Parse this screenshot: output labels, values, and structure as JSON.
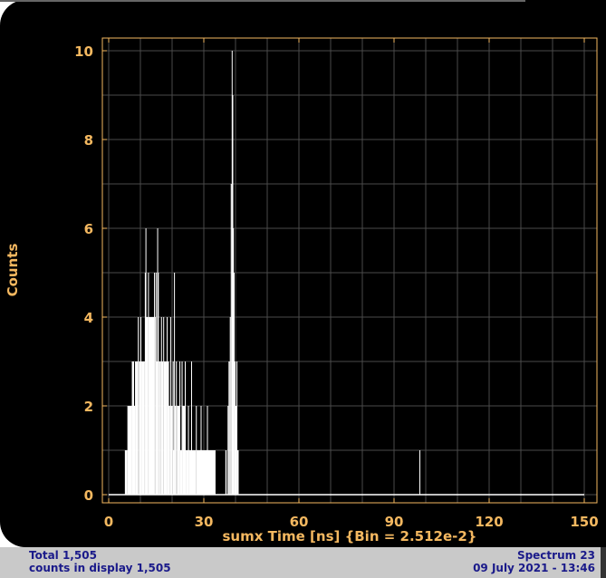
{
  "chart_data": {
    "type": "bar",
    "title": "",
    "xlabel": "sumx Time [ns] {Bin = 2.512e-2}",
    "ylabel": "Counts",
    "xlim": [
      -2,
      152
    ],
    "ylim": [
      -0.2,
      10.3
    ],
    "xticks": [
      "0",
      "30",
      "60",
      "90",
      "120",
      "150"
    ],
    "xtick_values": [
      0,
      30,
      60,
      90,
      120,
      150
    ],
    "yticks": [
      "0",
      "2",
      "4",
      "6",
      "8",
      "10"
    ],
    "ytick_values": [
      0,
      2,
      4,
      6,
      8,
      10
    ],
    "grid": true,
    "segments": [
      [
        5.1,
        5.9,
        1
      ],
      [
        5.9,
        7.3,
        2
      ],
      [
        7.3,
        8.0,
        3
      ],
      [
        8.0,
        8.3,
        2
      ],
      [
        8.3,
        9.2,
        3
      ],
      [
        9.2,
        9.5,
        4
      ],
      [
        9.5,
        10.0,
        3
      ],
      [
        10.0,
        10.3,
        4
      ],
      [
        10.3,
        11.4,
        3
      ],
      [
        11.4,
        11.6,
        5
      ],
      [
        11.6,
        11.8,
        6
      ],
      [
        11.8,
        12.4,
        4
      ],
      [
        12.4,
        12.6,
        5
      ],
      [
        12.6,
        14.3,
        4
      ],
      [
        14.3,
        14.5,
        5
      ],
      [
        14.5,
        14.8,
        4
      ],
      [
        14.8,
        15.0,
        5
      ],
      [
        15.0,
        15.3,
        3
      ],
      [
        15.3,
        15.4,
        6
      ],
      [
        15.4,
        15.8,
        5
      ],
      [
        15.8,
        16.5,
        3
      ],
      [
        16.5,
        16.7,
        4
      ],
      [
        16.7,
        17.2,
        3
      ],
      [
        17.2,
        17.4,
        4
      ],
      [
        17.4,
        18.3,
        3
      ],
      [
        18.3,
        18.5,
        4
      ],
      [
        18.5,
        19.0,
        3
      ],
      [
        19.0,
        19.4,
        2
      ],
      [
        19.4,
        19.6,
        4
      ],
      [
        19.6,
        20.2,
        2
      ],
      [
        20.2,
        20.4,
        3
      ],
      [
        20.4,
        20.6,
        1
      ],
      [
        20.6,
        20.8,
        5
      ],
      [
        20.8,
        21.2,
        2
      ],
      [
        21.2,
        21.5,
        3
      ],
      [
        21.5,
        22.3,
        2
      ],
      [
        22.3,
        22.5,
        3
      ],
      [
        22.5,
        23.0,
        1
      ],
      [
        23.0,
        23.3,
        3
      ],
      [
        23.3,
        24.0,
        2
      ],
      [
        24.0,
        24.3,
        3
      ],
      [
        24.3,
        25.0,
        1
      ],
      [
        25.0,
        25.3,
        2
      ],
      [
        25.3,
        26.0,
        1
      ],
      [
        26.0,
        26.2,
        3
      ],
      [
        26.2,
        27.5,
        1
      ],
      [
        27.5,
        27.7,
        2
      ],
      [
        27.7,
        29.0,
        1
      ],
      [
        29.0,
        29.2,
        2
      ],
      [
        29.2,
        31.0,
        1
      ],
      [
        31.0,
        31.2,
        2
      ],
      [
        31.2,
        33.7,
        1
      ],
      [
        36.8,
        37.2,
        1
      ],
      [
        37.5,
        37.8,
        2
      ],
      [
        37.8,
        38.2,
        3
      ],
      [
        38.2,
        38.5,
        4
      ],
      [
        38.5,
        38.8,
        7
      ],
      [
        38.8,
        39.0,
        10
      ],
      [
        39.0,
        39.2,
        9
      ],
      [
        39.2,
        39.4,
        6
      ],
      [
        39.4,
        39.7,
        5
      ],
      [
        39.7,
        40.0,
        3
      ],
      [
        40.0,
        40.3,
        2
      ],
      [
        40.3,
        40.5,
        3
      ],
      [
        40.5,
        41.0,
        1
      ],
      [
        98.0,
        98.2,
        1
      ]
    ],
    "baseline_range": [
      0,
      150
    ]
  },
  "status": {
    "total": "Total 1,505",
    "counts_in_display": "counts in display 1,505",
    "spectrum": "Spectrum 23",
    "datetime": "09 July 2021 - 13:46"
  },
  "colors": {
    "axis": "#f4b860",
    "grid": "#4a4a4a",
    "bars": "#ffffff",
    "status_text": "#1a1a8a"
  }
}
